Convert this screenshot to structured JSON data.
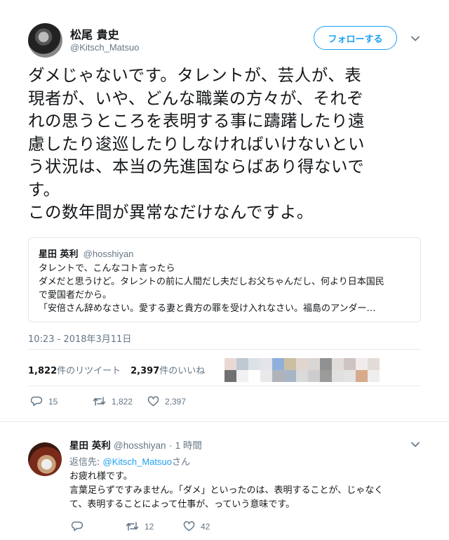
{
  "tweet": {
    "author_name": "松尾 貴史",
    "author_handle": "@Kitsch_Matsuo",
    "follow_label": "フォローする",
    "text": "ダメじゃないです。タレントが、芸人が、表\n現者が、いや、どんな職業の方々が、それぞ\nれの思うところを表明する事に躊躇したり遠\n慮したり逡巡したりしなければいけないとい\nう状況は、本当の先進国ならばあり得ないで\nす。\nこの数年間が異常なだけなんですよ。",
    "quote": {
      "name": "星田 英利",
      "handle": "@hosshiyan",
      "body": "タレントで、こんなコト言ったら\nダメだと思うけど。タレントの前に人間だし夫だしお父ちゃんだし、何より日本国民\nで愛国者だから。\n「安倍さん辞めなさい。愛する妻と貴方の罪を受け入れなさい。福島のアンダー…"
    },
    "timestamp": "10:23 - 2018年3月11日",
    "retweet_count": "1,822",
    "retweet_label": "件のリツイート",
    "like_count": "2,397",
    "like_label": "件のいいね",
    "actions": {
      "reply": "15",
      "retweet": "1,822",
      "like": "2,397"
    }
  },
  "reply": {
    "name": "星田 英利",
    "handle": "@hosshiyan",
    "sep": "·",
    "time": "1 時間",
    "reply_to_prefix": "返信先: ",
    "reply_to_handle": "@Kitsch_Matsuo",
    "reply_to_suffix": "さん",
    "text": "お疲れ様です。\n言葉足らずですみません。「ダメ」といったのは、表明することが、じゃなく\nて、表明することによって仕事が、っていう意味です。",
    "actions": {
      "reply": "",
      "retweet": "12",
      "like": "42"
    }
  },
  "colors": {
    "accent": "#1da1f2",
    "muted": "#657786",
    "border": "#e1e8ed"
  },
  "mosaic_colors": [
    "#ffffff",
    "#e9d9d5",
    "#bfc9d3",
    "#dde2e6",
    "#e4e4ea",
    "#8fb0dc",
    "#cbbfa2",
    "#e0d6cf",
    "#dad6d6",
    "#909292",
    "#e0dcda",
    "#cfc4c2",
    "#f1ebeb",
    "#e4dcd6",
    "#ffffff",
    "#707070",
    "#f2f0f2",
    "#ffffff",
    "#e9e9e9",
    "#b0b3b9",
    "#a8b5c7",
    "#d9dad9",
    "#cdcdcd",
    "#9b9c9a",
    "#e1e0e0",
    "#e4e3e3",
    "#d6ab8c",
    "#eeeeee"
  ]
}
